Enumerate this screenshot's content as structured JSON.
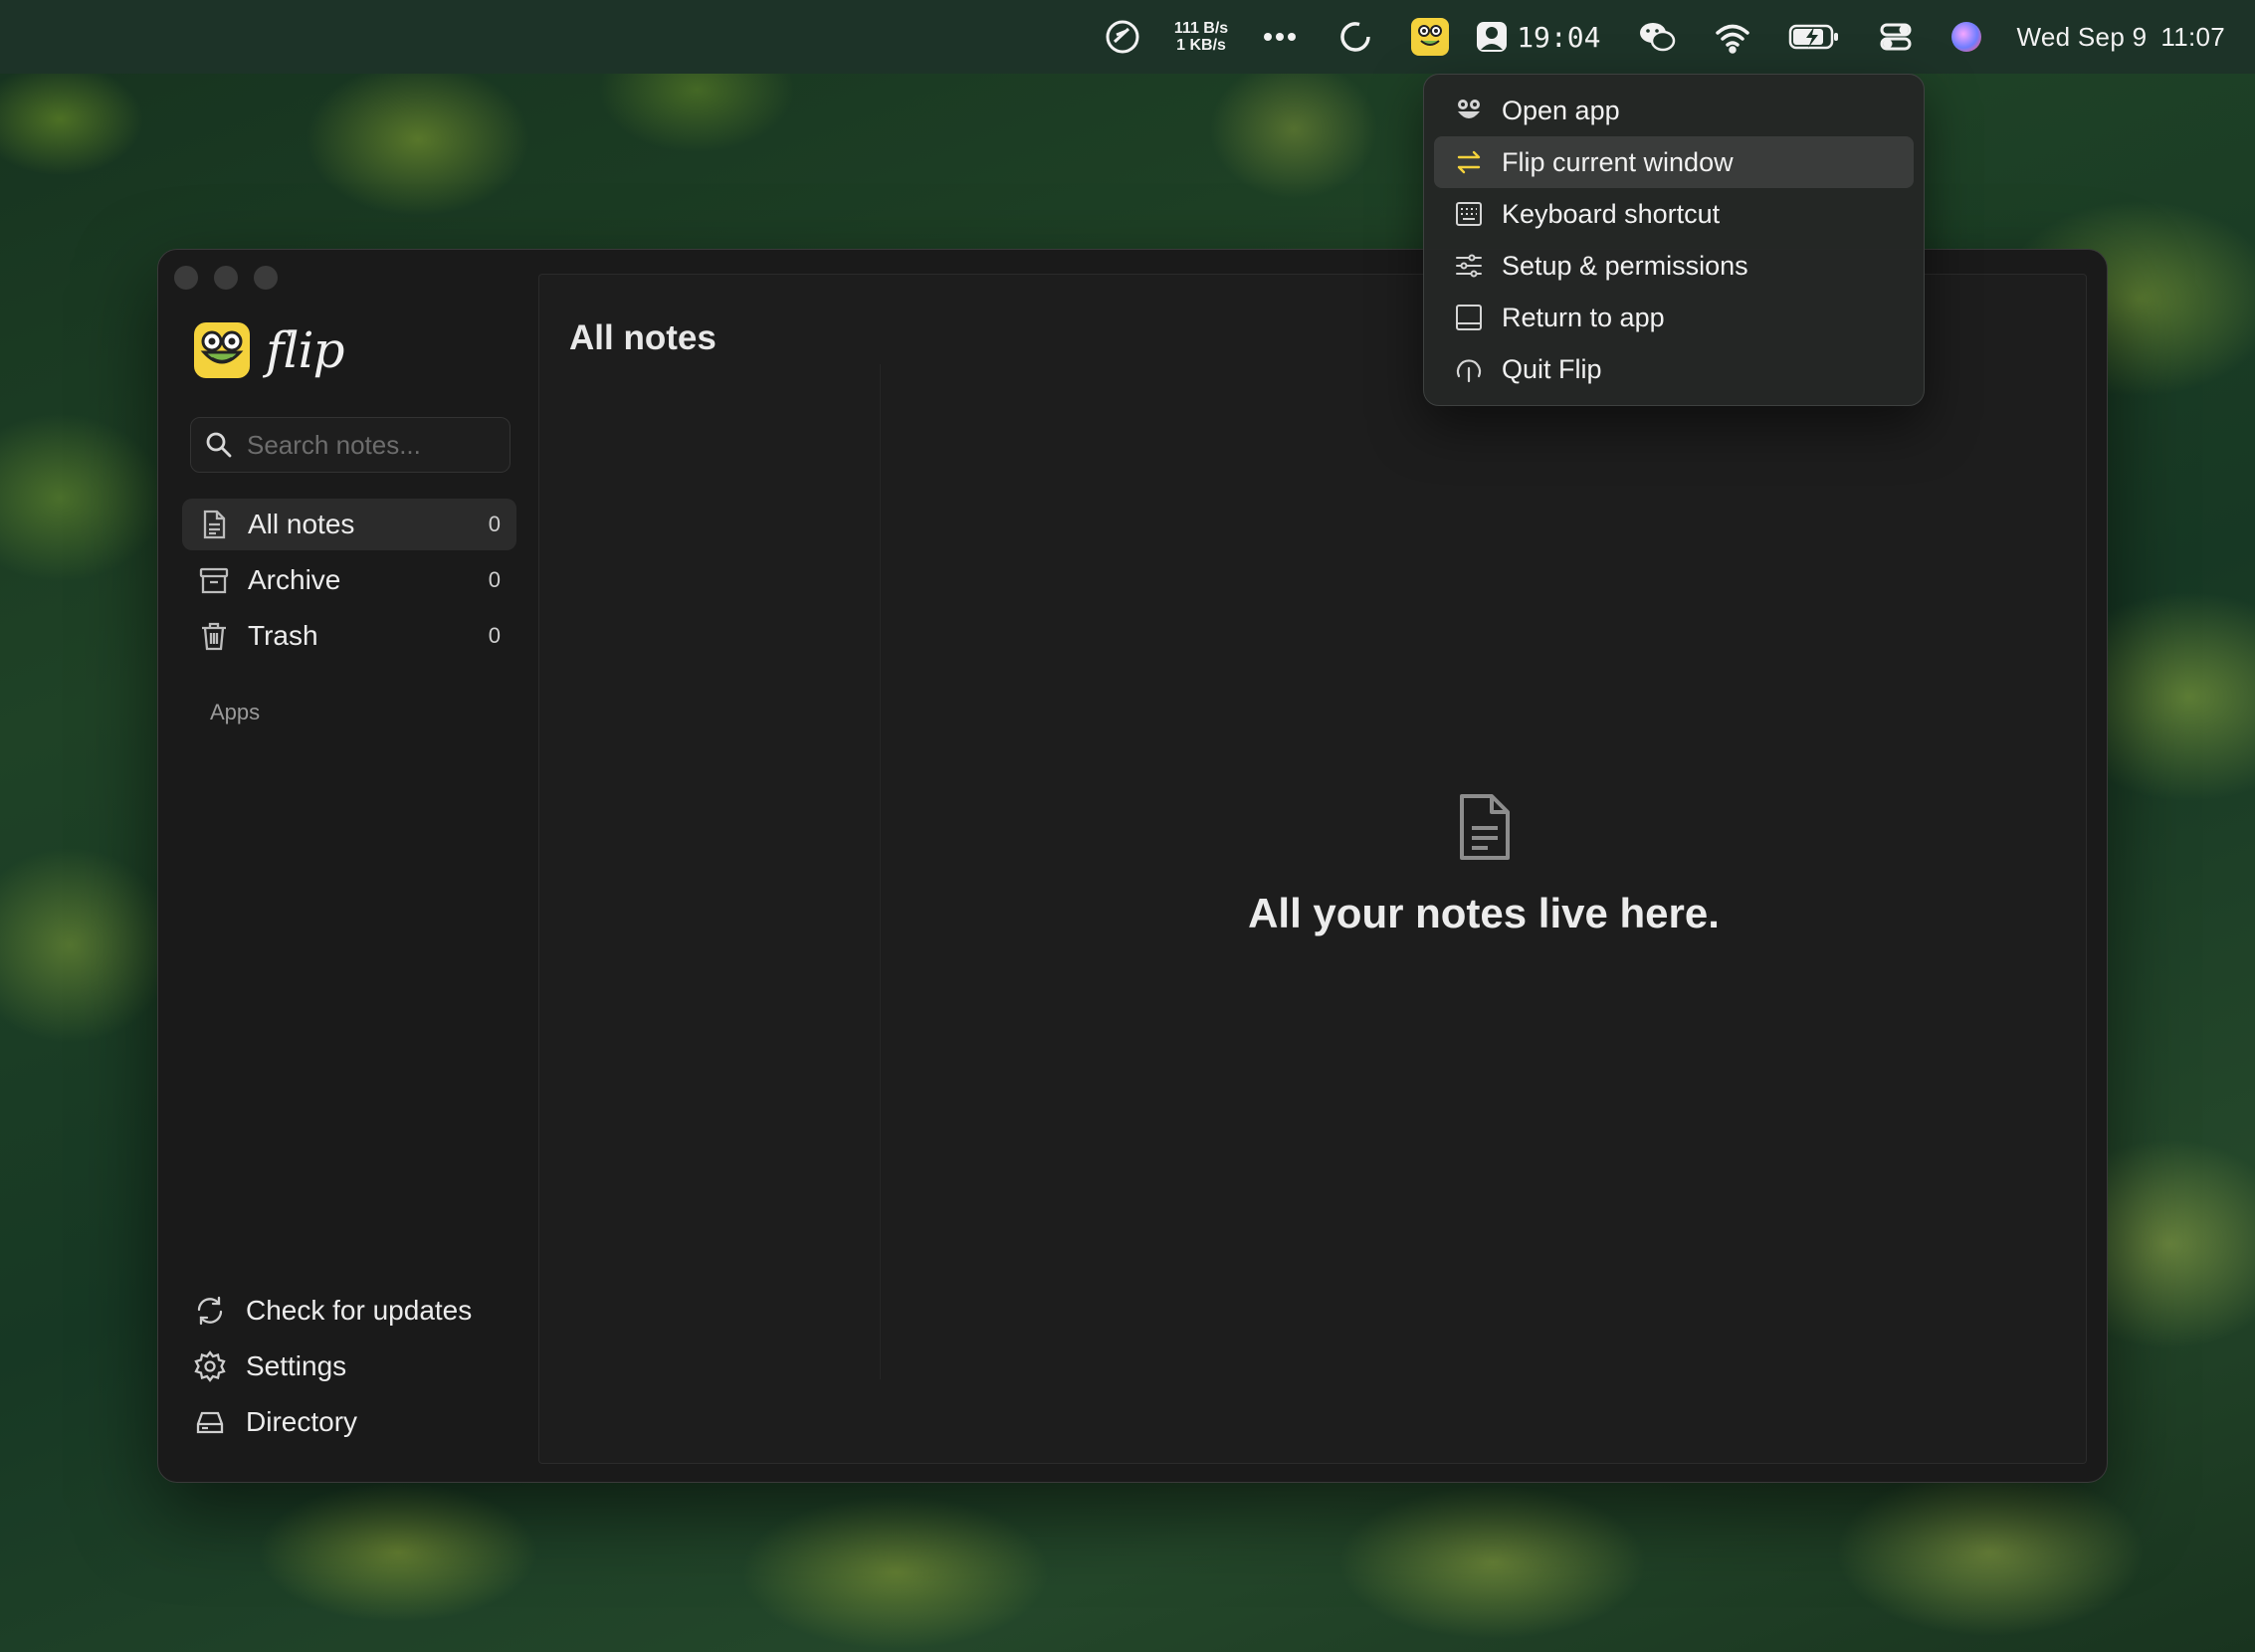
{
  "menubar": {
    "net_up": "111 B/s",
    "net_down": "1 KB/s",
    "timer": "19:04",
    "date": "Wed Sep 9",
    "time": "11:07"
  },
  "dropdown": {
    "items": [
      {
        "label": "Open app",
        "icon": "frog-icon"
      },
      {
        "label": "Flip current window",
        "icon": "swap-arrows-icon",
        "active": true
      },
      {
        "label": "Keyboard shortcut",
        "icon": "keyboard-icon"
      },
      {
        "label": "Setup & permissions",
        "icon": "sliders-icon"
      },
      {
        "label": "Return to app",
        "icon": "window-icon"
      },
      {
        "label": "Quit Flip",
        "icon": "power-icon"
      }
    ]
  },
  "app": {
    "name": "flip",
    "search_placeholder": "Search notes...",
    "nav": [
      {
        "label": "All notes",
        "count": "0",
        "icon": "document-icon",
        "active": true
      },
      {
        "label": "Archive",
        "count": "0",
        "icon": "archive-icon"
      },
      {
        "label": "Trash",
        "count": "0",
        "icon": "trash-icon"
      }
    ],
    "apps_section": "Apps",
    "bottom": [
      {
        "label": "Check for updates",
        "icon": "refresh-icon"
      },
      {
        "label": "Settings",
        "icon": "gear-icon"
      },
      {
        "label": "Directory",
        "icon": "drive-icon"
      }
    ],
    "main_title": "All notes",
    "empty_message": "All your notes live here."
  },
  "colors": {
    "accent": "#f4d23c",
    "menubar_bg": "#1d3328",
    "window_bg": "#1a1a1a"
  }
}
